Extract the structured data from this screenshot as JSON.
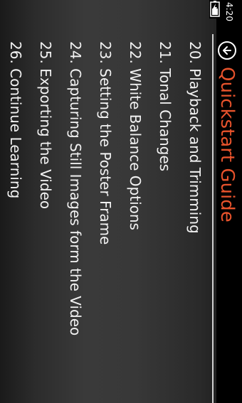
{
  "status": {
    "time": "4:20"
  },
  "header": {
    "title": "Quickstart Guide"
  },
  "list": {
    "items": [
      {
        "label": "20. Playback and Trimming"
      },
      {
        "label": "21. Tonal Changes"
      },
      {
        "label": "22. White Balance Options"
      },
      {
        "label": "23. Setting the Poster Frame"
      },
      {
        "label": "24. Capturing Still Images form the Video"
      },
      {
        "label": "25. Exporting the Video"
      },
      {
        "label": "26. Continue Learning"
      }
    ]
  },
  "colors": {
    "accent": "#e8532c",
    "text": "#f2f2f2",
    "background": "#333333"
  },
  "icons": {
    "back": "back-arrow-circle-icon",
    "battery": "battery-charging-icon"
  }
}
